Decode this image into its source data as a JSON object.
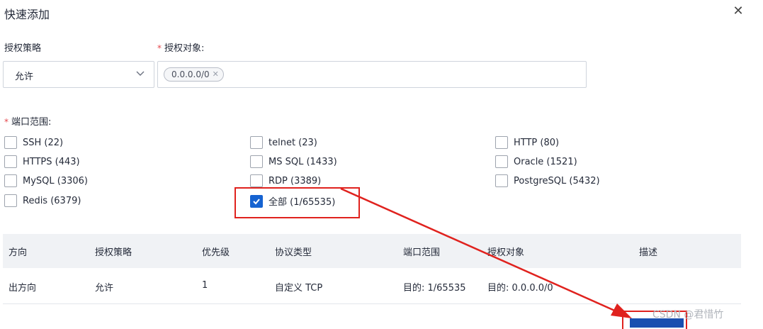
{
  "dialog": {
    "title": "快速添加"
  },
  "policy": {
    "label": "授权策略",
    "value": "允许"
  },
  "target": {
    "label": "授权对象:",
    "tag": "0.0.0.0/0"
  },
  "ports": {
    "label": "端口范围:",
    "options": [
      {
        "label": "SSH (22)",
        "checked": false
      },
      {
        "label": "telnet (23)",
        "checked": false
      },
      {
        "label": "HTTP (80)",
        "checked": false
      },
      {
        "label": "HTTPS (443)",
        "checked": false
      },
      {
        "label": "MS SQL (1433)",
        "checked": false
      },
      {
        "label": "Oracle (1521)",
        "checked": false
      },
      {
        "label": "MySQL (3306)",
        "checked": false
      },
      {
        "label": "RDP (3389)",
        "checked": false
      },
      {
        "label": "PostgreSQL (5432)",
        "checked": false
      },
      {
        "label": "Redis (6379)",
        "checked": false
      },
      {
        "label": "全部 (1/65535)",
        "checked": true
      }
    ]
  },
  "table": {
    "headers": [
      "方向",
      "授权策略",
      "优先级",
      "协议类型",
      "端口范围",
      "授权对象",
      "描述"
    ],
    "rows": [
      [
        "出方向",
        "允许",
        "1",
        "自定义 TCP",
        "目的: 1/65535",
        "目的: 0.0.0.0/0",
        ""
      ]
    ]
  },
  "watermark": "CSDN @君惜竹",
  "colors": {
    "accent": "#1663d1",
    "annotation": "#e0221e"
  }
}
